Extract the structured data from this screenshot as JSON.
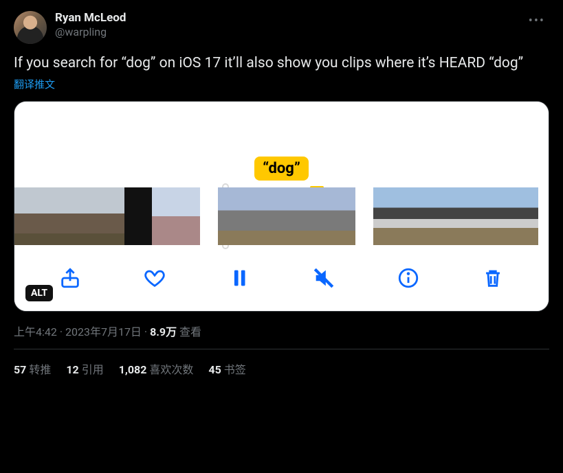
{
  "author": {
    "display_name": "Ryan McLeod",
    "handle": "@warpling"
  },
  "tweet": {
    "text": "If you search for “dog” on iOS 17 it’ll also show you clips where it’s HEARD “dog”",
    "translate_label": "翻译推文"
  },
  "media": {
    "tag_label": "“dog”",
    "alt_badge": "ALT",
    "icons": {
      "share": "share-icon",
      "like": "heart-icon",
      "pause": "pause-icon",
      "mute": "mute-icon",
      "info": "info-icon",
      "trash": "trash-icon"
    }
  },
  "meta": {
    "time": "上午4:42",
    "date": "2023年7月17日",
    "views_count": "8.9万",
    "views_label": "查看",
    "separator": " · "
  },
  "stats": {
    "retweets": {
      "count": "57",
      "label": "转推"
    },
    "quotes": {
      "count": "12",
      "label": "引用"
    },
    "likes": {
      "count": "1,082",
      "label": "喜欢次数"
    },
    "bookmarks": {
      "count": "45",
      "label": "书签"
    }
  }
}
